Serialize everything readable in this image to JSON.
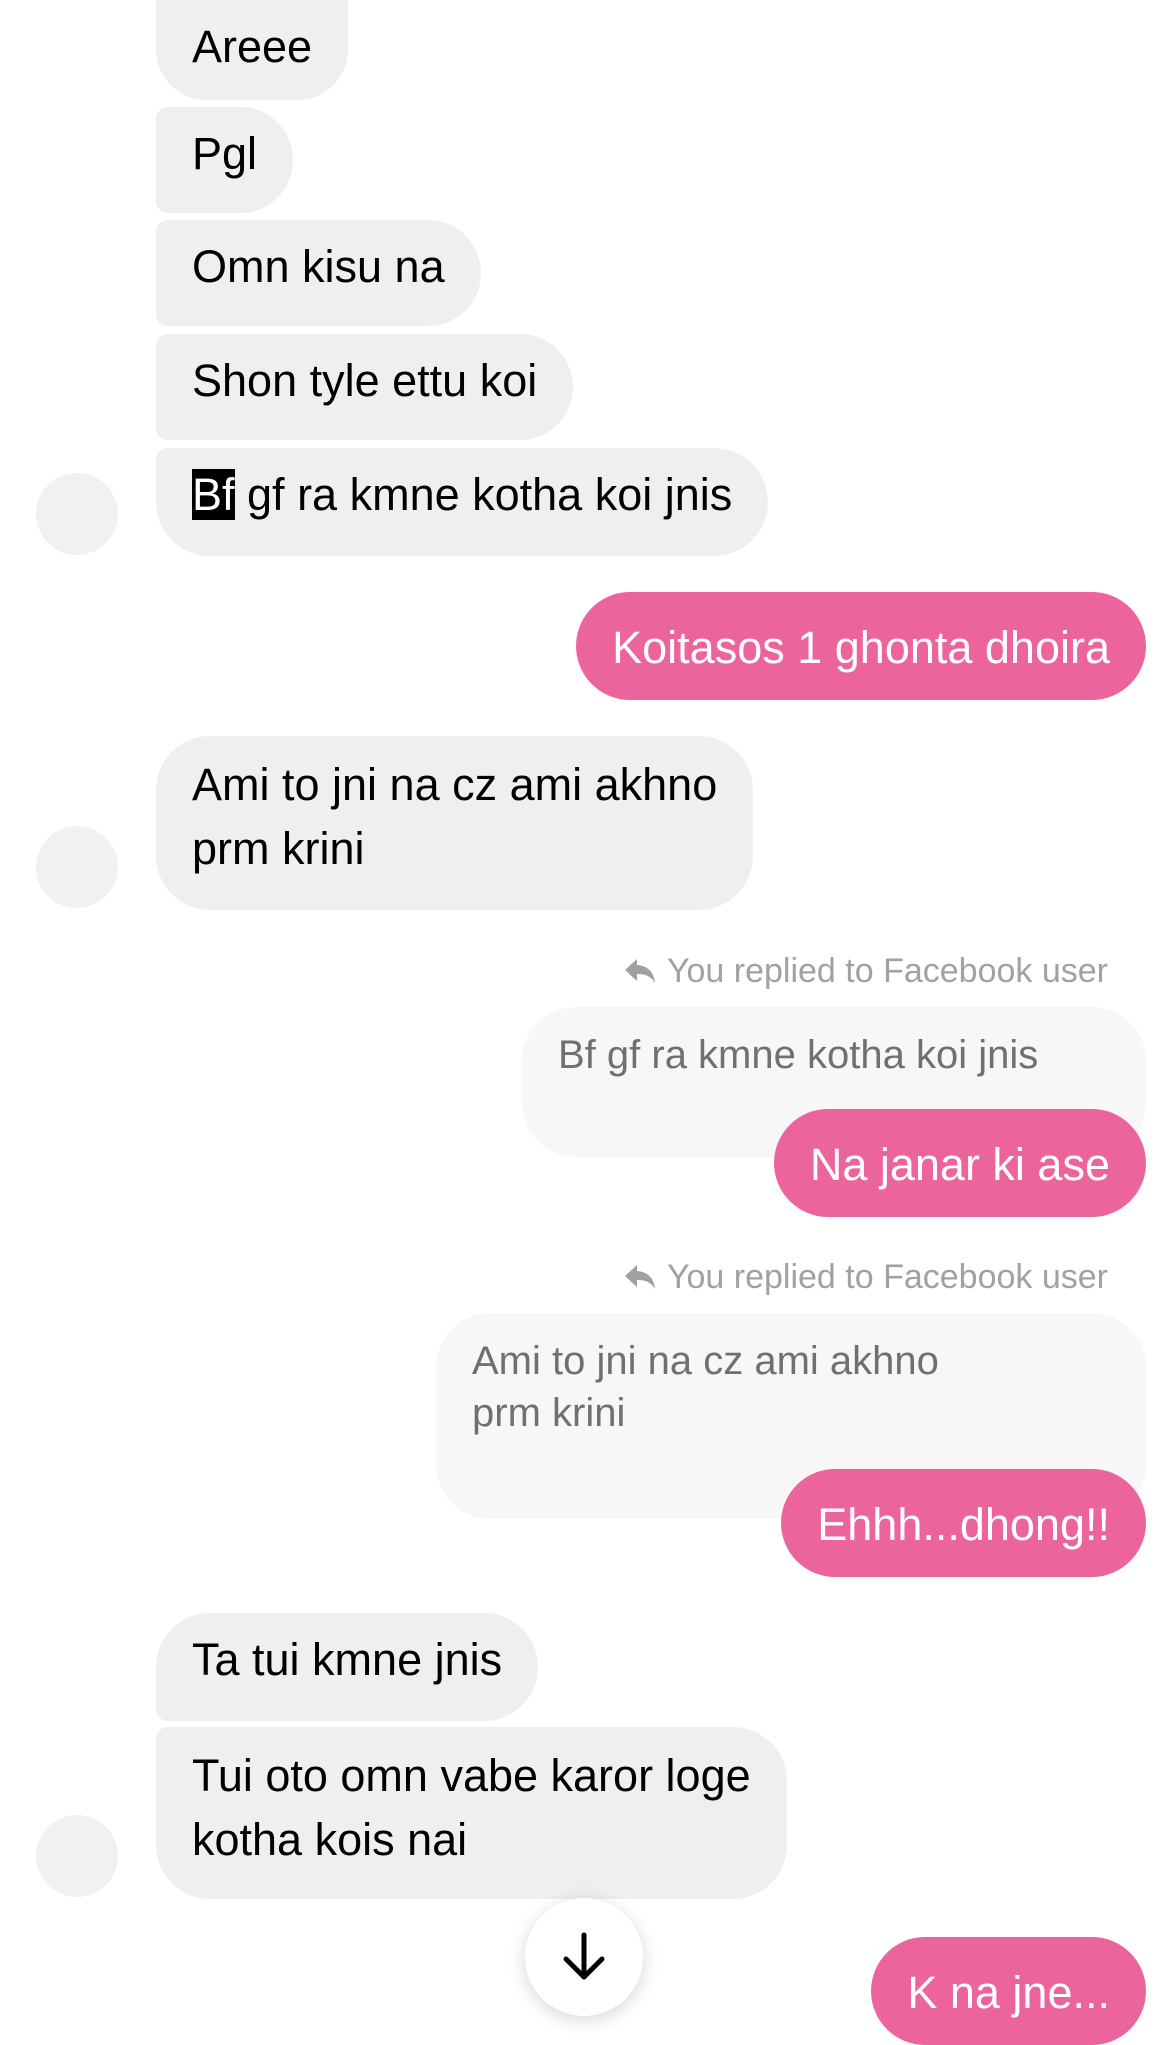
{
  "colors": {
    "incoming_bubble": "#efefef",
    "outgoing_bubble": "#ec649c",
    "quoted_bubble": "#f7f7f7",
    "reply_note_text": "#a1a1a1"
  },
  "messages": {
    "m1": "Areee",
    "m2": "Pgl",
    "m3": "Omn kisu na",
    "m4": "Shon tyle ettu koi",
    "m5_highlight": "Bf",
    "m5_rest": " gf ra kmne kotha koi jnis",
    "m6": "Koitasos 1 ghonta dhoira",
    "m7_line1": "Ami to jni na cz ami akhno",
    "m7_line2": "prm krini",
    "reply1_note": "You replied to Facebook user",
    "reply1_quote": "Bf gf ra kmne kotha koi jnis",
    "m8": "Na janar ki ase",
    "reply2_note": "You replied to Facebook user",
    "reply2_quote_line1": "Ami to jni na cz ami akhno",
    "reply2_quote_line2": "prm krini",
    "m9": "Ehhh...dhong!!",
    "m10": "Ta tui kmne jnis",
    "m11_line1": "Tui oto omn vabe karor loge",
    "m11_line2": "kotha kois nai",
    "m12": "K na jne..."
  },
  "icons": {
    "reply": "reply-arrow-icon",
    "scroll_down": "arrow-down-icon"
  }
}
